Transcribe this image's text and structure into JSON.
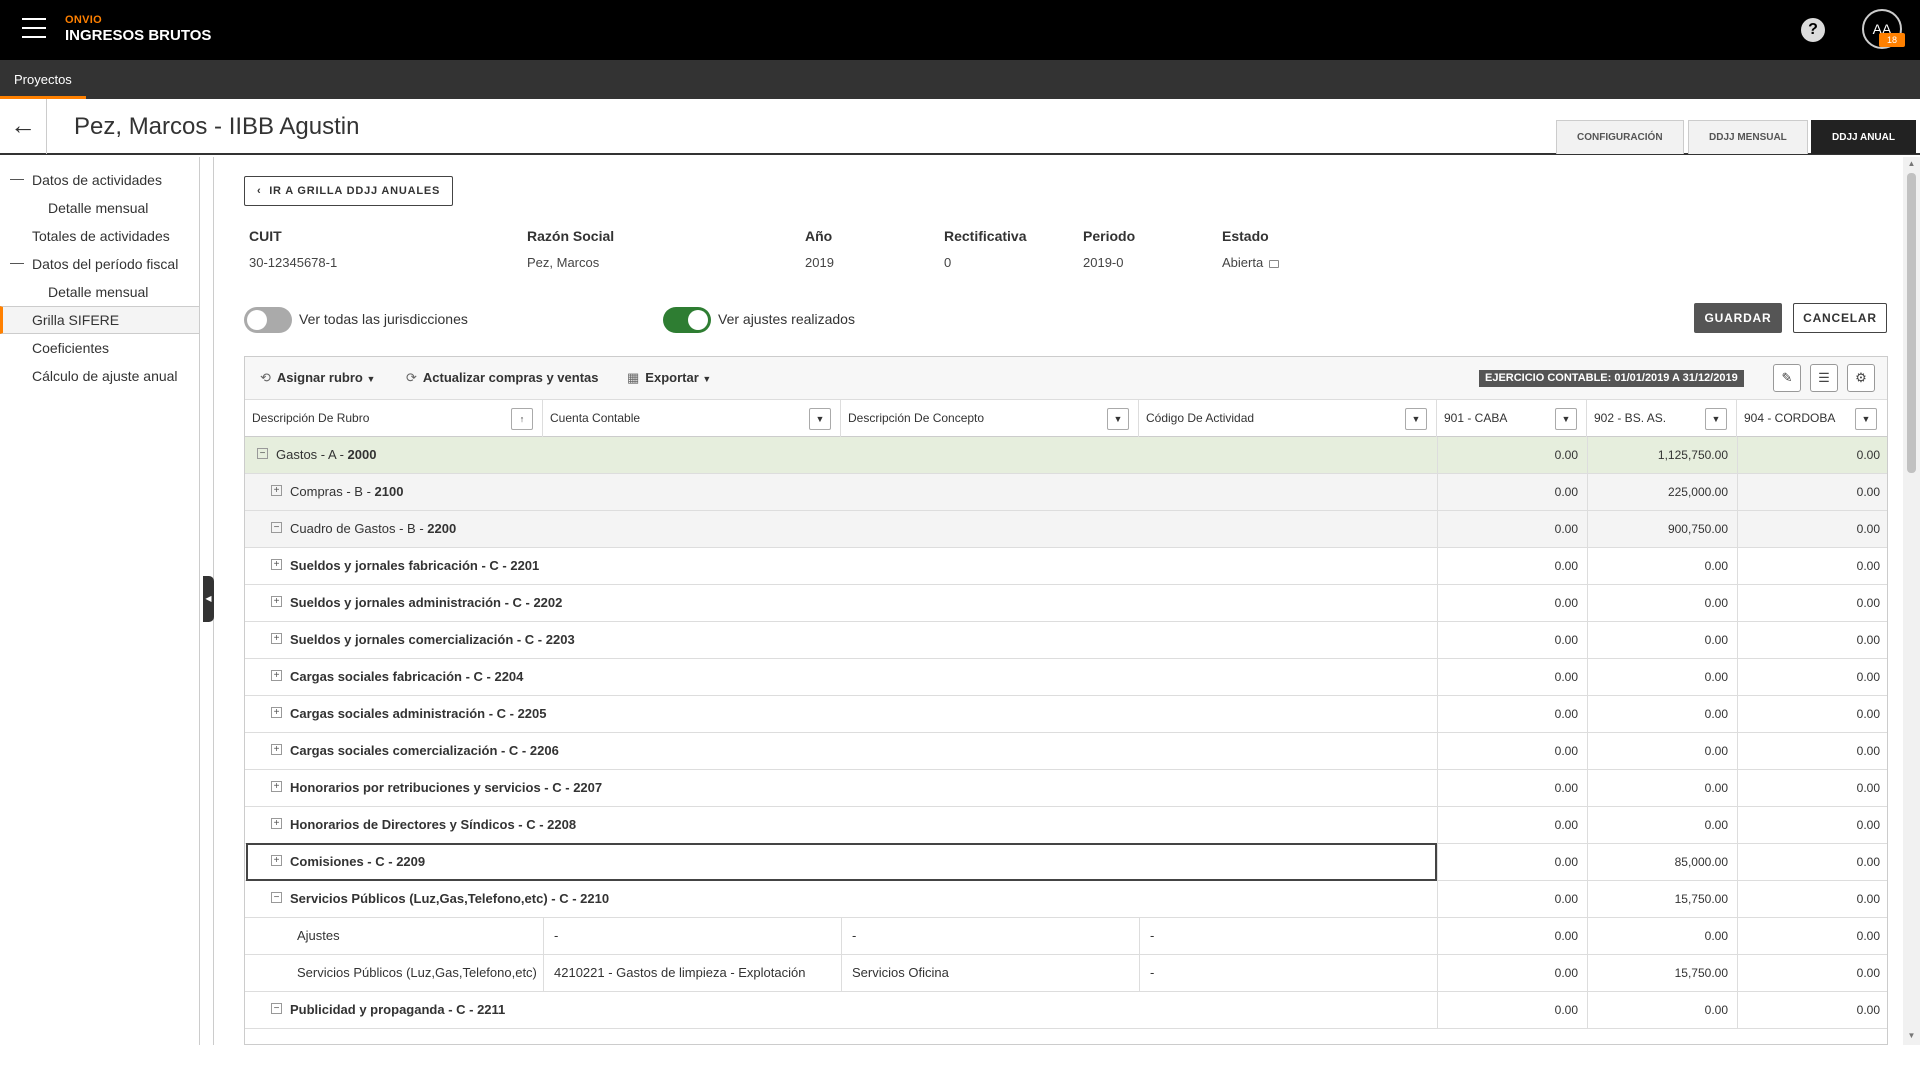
{
  "app": {
    "brand_sub": "ONVIO",
    "brand_main": "INGRESOS BRUTOS",
    "avatar_initials": "AA",
    "avatar_badge": "18",
    "help": "?"
  },
  "nav": {
    "tab": "Proyectos"
  },
  "title": {
    "text": "Pez, Marcos - IIBB Agustin",
    "back": "←"
  },
  "tabs": [
    "CONFIGURACIÓN",
    "DDJJ MENSUAL",
    "DDJJ ANUAL"
  ],
  "sidebar": {
    "items": [
      "Datos de actividades",
      "Detalle mensual",
      "Totales de actividades",
      "Datos del período fiscal",
      "Detalle mensual",
      "Grilla SIFERE",
      "Coeficientes",
      "Cálculo de ajuste anual"
    ]
  },
  "main": {
    "ir_button": "IR A GRILLA DDJJ ANUALES",
    "fields": {
      "cuit_label": "CUIT",
      "cuit_value": "30-12345678-1",
      "razon_label": "Razón Social",
      "razon_value": "Pez, Marcos",
      "anio_label": "Año",
      "anio_value": "2019",
      "rect_label": "Rectificativa",
      "rect_value": "0",
      "periodo_label": "Periodo",
      "periodo_value": "2019-0",
      "estado_label": "Estado",
      "estado_value": "Abierta"
    },
    "toggles": {
      "jurisdicciones": {
        "label": "Ver todas las jurisdicciones",
        "on": false
      },
      "ajustes": {
        "label": "Ver ajustes realizados",
        "on": true
      }
    },
    "guardar": "GUARDAR",
    "cancelar": "CANCELAR"
  },
  "grid": {
    "toolbar": {
      "asignar": "Asignar rubro",
      "actualizar": "Actualizar compras y ventas",
      "exportar": "Exportar",
      "ejercicio": "EJERCICIO CONTABLE: 01/01/2019 A 31/12/2019"
    },
    "columns": [
      "Descripción De Rubro",
      "Cuenta Contable",
      "Descripción De Concepto",
      "Código De Actividad",
      "901 - CABA",
      "902 - BS. AS.",
      "904 - CORDOBA"
    ],
    "rows": [
      {
        "name": "Gastos - A - ",
        "code": "2000",
        "exp": "−",
        "c901": "0.00",
        "c902": "1,125,750.00",
        "c904": "0.00"
      },
      {
        "name": "Compras - B - ",
        "code": "2100",
        "exp": "+",
        "c901": "0.00",
        "c902": "225,000.00",
        "c904": "0.00"
      },
      {
        "name": "Cuadro de Gastos - B - ",
        "code": "2200",
        "exp": "−",
        "c901": "0.00",
        "c902": "900,750.00",
        "c904": "0.00"
      },
      {
        "name": "Sueldos y jornales fabricación - C - ",
        "code": "2201",
        "exp": "+",
        "c901": "0.00",
        "c902": "0.00",
        "c904": "0.00"
      },
      {
        "name": "Sueldos y jornales administración - C - ",
        "code": "2202",
        "exp": "+",
        "c901": "0.00",
        "c902": "0.00",
        "c904": "0.00"
      },
      {
        "name": "Sueldos y jornales comercialización - C - ",
        "code": "2203",
        "exp": "+",
        "c901": "0.00",
        "c902": "0.00",
        "c904": "0.00"
      },
      {
        "name": "Cargas sociales fabricación - C - ",
        "code": "2204",
        "exp": "+",
        "c901": "0.00",
        "c902": "0.00",
        "c904": "0.00"
      },
      {
        "name": "Cargas sociales administración - C - ",
        "code": "2205",
        "exp": "+",
        "c901": "0.00",
        "c902": "0.00",
        "c904": "0.00"
      },
      {
        "name": "Cargas sociales comercialización - C - ",
        "code": "2206",
        "exp": "+",
        "c901": "0.00",
        "c902": "0.00",
        "c904": "0.00"
      },
      {
        "name": "Honorarios por retribuciones y servicios - C - ",
        "code": "2207",
        "exp": "+",
        "c901": "0.00",
        "c902": "0.00",
        "c904": "0.00"
      },
      {
        "name": "Honorarios de Directores y Síndicos - C - ",
        "code": "2208",
        "exp": "+",
        "c901": "0.00",
        "c902": "0.00",
        "c904": "0.00"
      },
      {
        "name": "Comisiones - C - ",
        "code": "2209",
        "exp": "+",
        "c901": "0.00",
        "c902": "85,000.00",
        "c904": "0.00"
      },
      {
        "name": "Servicios Públicos (Luz,Gas,Telefono,etc) - C - ",
        "code": "2210",
        "exp": "−",
        "c901": "0.00",
        "c902": "15,750.00",
        "c904": "0.00"
      },
      {
        "name": "Ajustes",
        "cuenta": "-",
        "concepto": "-",
        "actividad": "-",
        "c901": "0.00",
        "c902": "0.00",
        "c904": "0.00"
      },
      {
        "name": "Servicios Públicos (Luz,Gas,Telefono,etc)",
        "cuenta": "4210221 - Gastos de limpieza - Explotación",
        "concepto": "Servicios Oficina",
        "actividad": "-",
        "c901": "0.00",
        "c902": "15,750.00",
        "c904": "0.00"
      },
      {
        "name": "Publicidad y propaganda - C - ",
        "code": "2211",
        "exp": "−",
        "c901": "0.00",
        "c902": "0.00",
        "c904": "0.00"
      }
    ]
  }
}
